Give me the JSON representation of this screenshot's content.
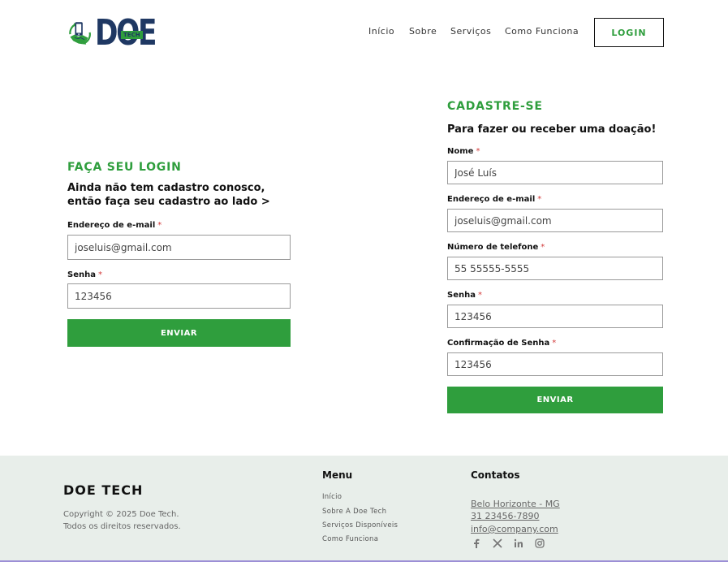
{
  "brand": {
    "logo_word": "DOE",
    "logo_tag": "TECH"
  },
  "nav": {
    "items": [
      "Início",
      "Sobre",
      "Serviços",
      "Como Funciona"
    ],
    "login_label": "LOGIN"
  },
  "login_form": {
    "title": "FAÇA SEU LOGIN",
    "subtitle_line1": "Ainda não tem cadastro conosco,",
    "subtitle_line2": "então faça seu cadastro ao lado >",
    "email_label": "Endereço de e-mail",
    "email_value": "joseluis@gmail.com",
    "password_label": "Senha",
    "password_value": "123456",
    "submit_label": "ENVIAR",
    "required_mark": "*"
  },
  "register_form": {
    "title": "CADASTRE-SE",
    "subtitle": "Para fazer ou receber uma doação!",
    "name_label": "Nome",
    "name_value": "José Luís",
    "email_label": "Endereço de e-mail",
    "email_value": "joseluis@gmail.com",
    "phone_label": "Número de telefone",
    "phone_value": "55 55555-5555",
    "password_label": "Senha",
    "password_value": "123456",
    "confirm_label": "Confirmação de Senha",
    "confirm_value": "123456",
    "submit_label": "ENVIAR",
    "required_mark": "*"
  },
  "footer": {
    "brand": "DOE TECH",
    "copyright_line1": "Copyright © 2025 Doe Tech.",
    "copyright_line2": "Todos os direitos reservados.",
    "menu_title": "Menu",
    "menu_items": [
      "Início",
      "Sobre A Doe Tech",
      "Serviços Disponíveis",
      "Como Funciona"
    ],
    "contacts_title": "Contatos",
    "contacts": [
      "Belo Horizonte - MG",
      "31 23456-7890",
      "info@company.com"
    ],
    "social_icons": [
      "facebook-icon",
      "x-icon",
      "linkedin-icon",
      "instagram-icon"
    ]
  },
  "colors": {
    "green": "#2f9e3d",
    "navy": "#1f3863",
    "footer_bg": "#e8eeea"
  }
}
